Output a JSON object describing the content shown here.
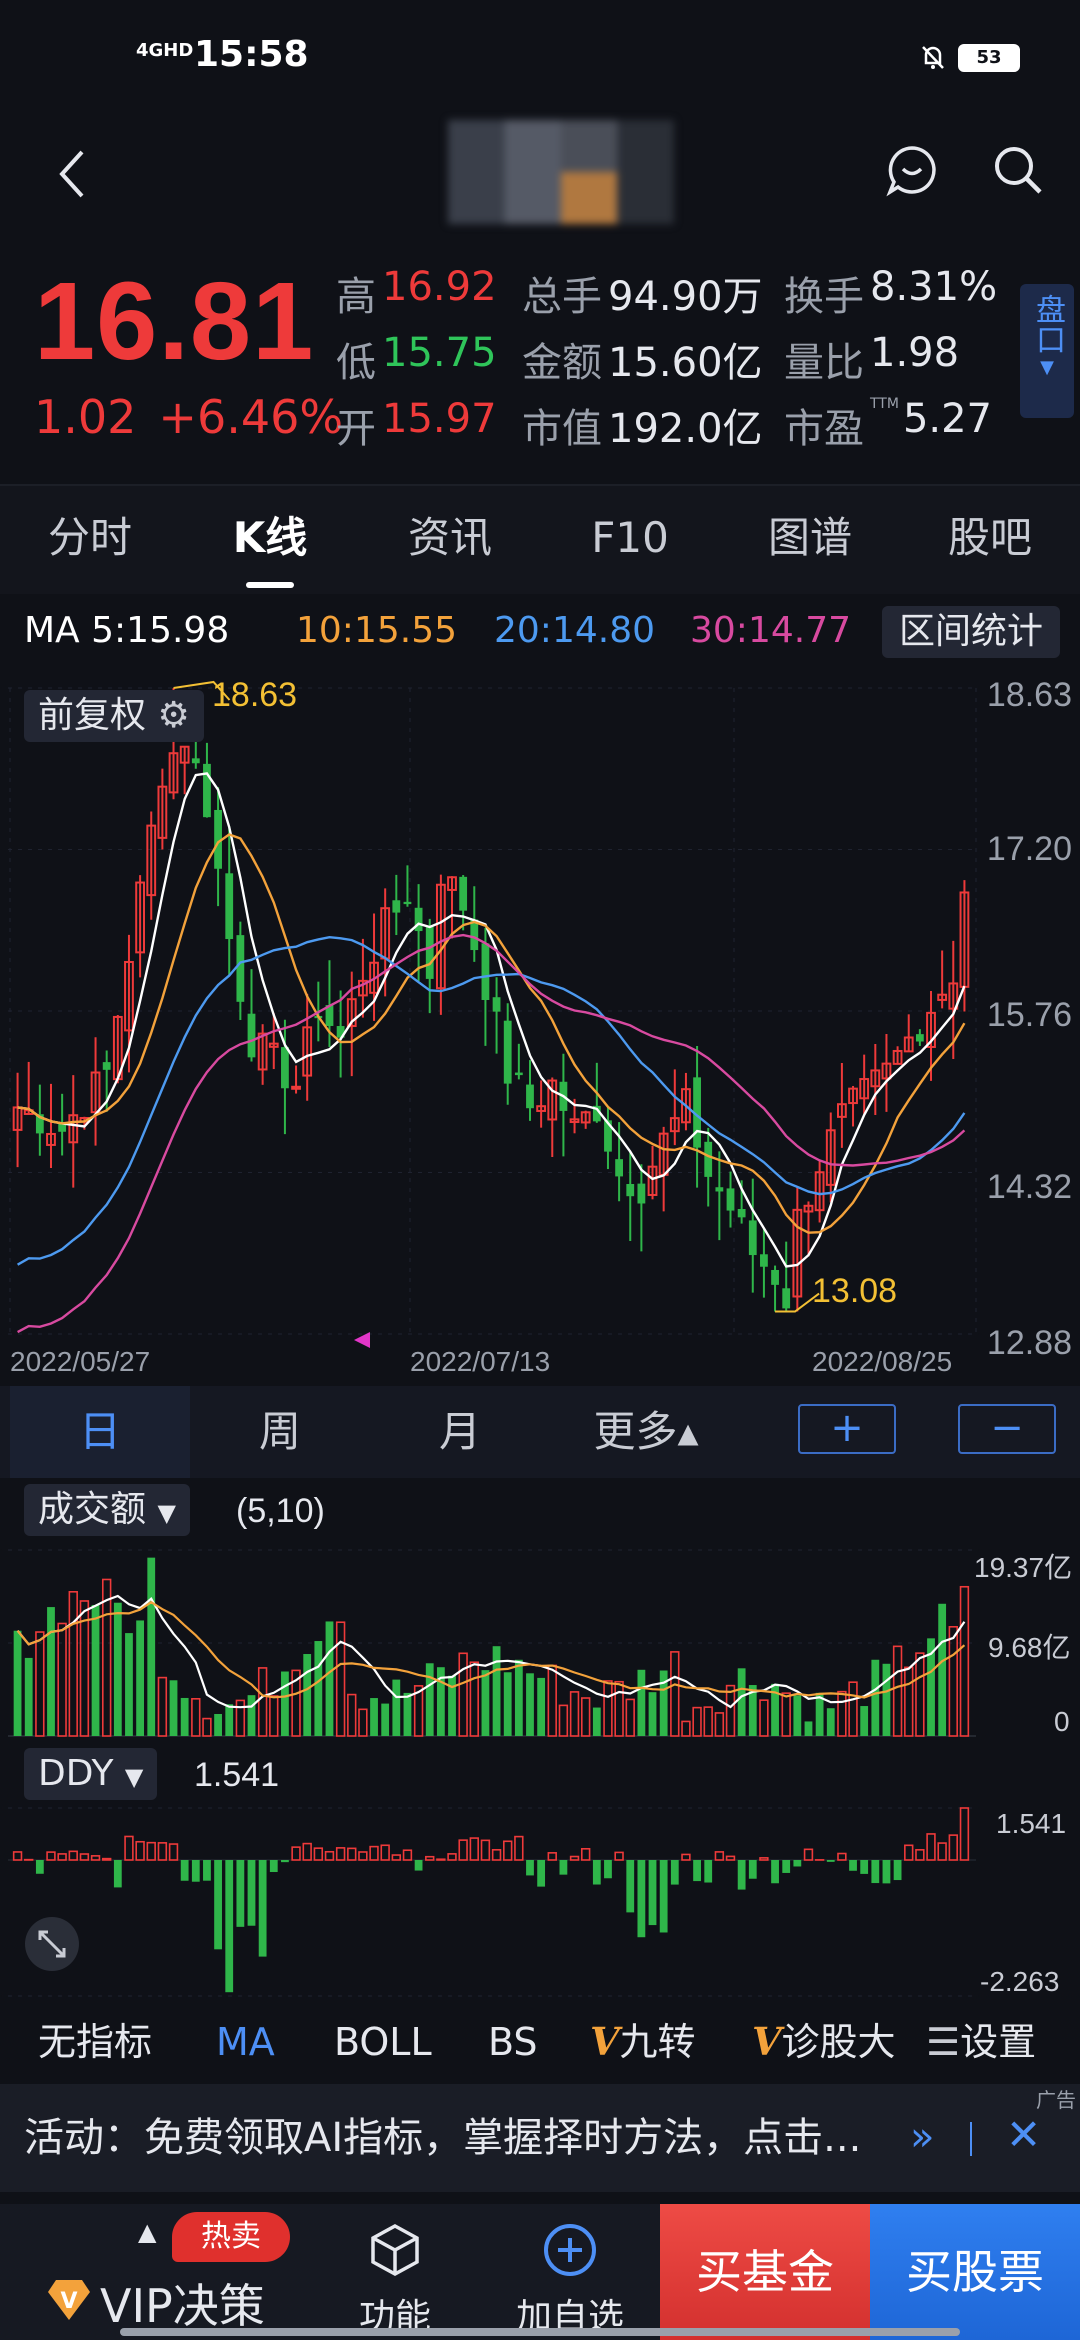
{
  "status_bar": {
    "signal": "4GHD",
    "time": "15:58",
    "battery": "53"
  },
  "quote": {
    "price": "16.81",
    "change": "1.02",
    "change_pct": "+6.46%",
    "rows": [
      [
        {
          "label": "高",
          "value": "16.92",
          "color": "red"
        },
        {
          "label": "总手",
          "value": "94.90万",
          "color": "white"
        },
        {
          "label": "换手",
          "value": "8.31%",
          "color": "white"
        }
      ],
      [
        {
          "label": "低",
          "value": "15.75",
          "color": "green"
        },
        {
          "label": "金额",
          "value": "15.60亿",
          "color": "white"
        },
        {
          "label": "量比",
          "value": "1.98",
          "color": "white"
        }
      ],
      [
        {
          "label": "开",
          "value": "15.97",
          "color": "red"
        },
        {
          "label": "市值",
          "value": "192.0亿",
          "color": "white"
        },
        {
          "label": "市盈",
          "value": "5.27",
          "color": "white",
          "sup": "TTM"
        }
      ]
    ],
    "side_button": "盘口"
  },
  "tabs": [
    "分时",
    "K线",
    "资讯",
    "F10",
    "图谱",
    "股吧"
  ],
  "active_tab": 1,
  "ma_legend": {
    "ma5": "MA 5:15.98",
    "ma10": "10:15.55",
    "ma20": "20:14.80",
    "ma30": "30:14.77",
    "stat_button": "区间统计"
  },
  "colors": {
    "ma5": "#ffffff",
    "ma10": "#f3a23b",
    "ma20": "#4d9af0",
    "ma30": "#d84aa0",
    "up": "#ee3a3a",
    "down": "#2fb64a",
    "accent": "#4d8ff5"
  },
  "kline": {
    "adjust_button": "前复权",
    "price_axis": [
      "18.63",
      "17.20",
      "15.76",
      "14.32",
      "12.88"
    ],
    "high_label": "18.63",
    "low_label": "13.08",
    "dates": [
      "2022/05/27",
      "2022/07/13",
      "2022/08/25"
    ]
  },
  "chart_data": [
    {
      "type": "candlestick",
      "ylim": [
        12.88,
        18.63
      ],
      "x_labels": [
        "2022/05/27",
        "2022/07/13",
        "2022/08/25"
      ],
      "series": [
        {
          "name": "MA 5",
          "last": 15.98
        },
        {
          "name": "MA 10",
          "last": 15.55
        },
        {
          "name": "MA 20",
          "last": 14.8
        },
        {
          "name": "MA 30",
          "last": 14.77
        }
      ],
      "annotations": [
        {
          "label": "18.63"
        },
        {
          "label": "13.08"
        }
      ]
    },
    {
      "type": "bar",
      "title": "成交额",
      "params": "(5,10)",
      "ylim": [
        0,
        19.37
      ],
      "y_ticks": [
        "19.37亿",
        "9.68亿",
        "0"
      ]
    },
    {
      "type": "bar",
      "title": "DDY",
      "value": 1.541,
      "ylim": [
        -2.263,
        1.541
      ],
      "y_ticks": [
        "1.541",
        "-2.263"
      ]
    }
  ],
  "period": {
    "items": [
      "日",
      "周",
      "月",
      "更多▴"
    ],
    "active": 0,
    "plus": "+",
    "minus": "−"
  },
  "volume": {
    "label": "成交额",
    "params": "(5,10)",
    "axis": [
      "19.37亿",
      "9.68亿",
      "0"
    ]
  },
  "ddy": {
    "label": "DDY",
    "value": "1.541",
    "axis": [
      "1.541",
      "-2.263"
    ]
  },
  "indicators": {
    "items": [
      "无指标",
      "MA",
      "BOLL",
      "BS",
      "九转",
      "诊股大",
      "设置"
    ],
    "v_marks": [
      "V",
      "V"
    ],
    "active": 1
  },
  "activity": {
    "text": "活动：免费领取AI指标，掌握择时方法，点击...",
    "ad": "广告"
  },
  "bottom": {
    "vip_label": "VIP决策",
    "hot_badge": "热卖",
    "func": "功能",
    "fav": "加自选",
    "buy_fund": "买基金",
    "buy_stock": "买股票"
  }
}
